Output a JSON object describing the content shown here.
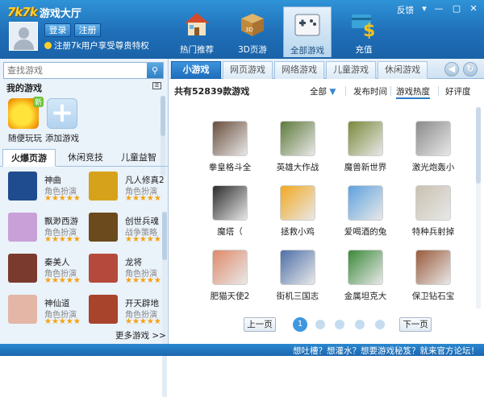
{
  "header": {
    "logo_mark": "7k7k",
    "app_title": "游戏大厅",
    "login_label": "登录",
    "register_label": "注册",
    "promo_text": "注册7k用户享受尊贵特权",
    "feedback_label": "反馈",
    "nav_tabs": [
      {
        "label": "热门推荐",
        "icon": "house-icon",
        "active": false
      },
      {
        "label": "3D页游",
        "icon": "box-icon",
        "active": false
      },
      {
        "label": "全部游戏",
        "icon": "gamepad-icon",
        "active": true
      },
      {
        "label": "充值",
        "icon": "dollar-card-icon",
        "active": false
      }
    ]
  },
  "sidebar": {
    "search_placeholder": "查找游戏",
    "my_games_heading": "我的游戏",
    "my_games": [
      {
        "label": "随便玩玩",
        "badge": "新"
      },
      {
        "label": "添加游戏"
      }
    ],
    "category_tabs": [
      {
        "label": "火爆页游",
        "active": true
      },
      {
        "label": "休闲竞技",
        "active": false
      },
      {
        "label": "儿童益智",
        "active": false
      }
    ],
    "games": [
      {
        "name": "神曲",
        "category": "角色扮演",
        "stars": "★★★★★",
        "color": "#1f4c8f"
      },
      {
        "name": "凡人修真2",
        "category": "角色扮演",
        "stars": "★★★★★",
        "color": "#d6a21c"
      },
      {
        "name": "飘渺西游",
        "category": "角色扮演",
        "stars": "★★★★★",
        "color": "#c9a0d8"
      },
      {
        "name": "创世兵魂",
        "category": "战争策略",
        "stars": "★★★★★",
        "color": "#6b4a1e"
      },
      {
        "name": "秦美人",
        "category": "角色扮演",
        "stars": "★★★★★",
        "color": "#7a3b2e"
      },
      {
        "name": "龙将",
        "category": "角色扮演",
        "stars": "★★★★★",
        "color": "#b54a3c"
      },
      {
        "name": "神仙道",
        "category": "角色扮演",
        "stars": "★★★★★",
        "color": "#e3b6a6"
      },
      {
        "name": "开天辟地",
        "category": "角色扮演",
        "stars": "★★★★★",
        "color": "#a8432c"
      }
    ],
    "more_label": "更多游戏 >>"
  },
  "main": {
    "sub_tabs": [
      {
        "label": "小游戏",
        "active": true
      },
      {
        "label": "网页游戏",
        "active": false
      },
      {
        "label": "网络游戏",
        "active": false
      },
      {
        "label": "儿童游戏",
        "active": false
      },
      {
        "label": "休闲游戏",
        "active": false
      }
    ],
    "total_text": "共有52839款游戏",
    "filters": {
      "all_label": "全部",
      "publish_time": "发布时间",
      "popularity": "游戏热度",
      "rating": "好评度"
    },
    "games": [
      {
        "name": "拳皇格斗全",
        "color": "#6a4e3c"
      },
      {
        "name": "英雄大作战",
        "color": "#5e7a3a"
      },
      {
        "name": "魔兽新世界",
        "color": "#7a8a3a"
      },
      {
        "name": "激光炮轰小",
        "color": "#8a8a8a"
      },
      {
        "name": "魔塔（",
        "color": "#2b2b2b"
      },
      {
        "name": "拯救小鸡",
        "color": "#f2a81f"
      },
      {
        "name": "爱喝酒的兔",
        "color": "#5da2e0"
      },
      {
        "name": "特种兵射掉",
        "color": "#c9c0b0"
      },
      {
        "name": "肥猫天使2",
        "color": "#e08a6a"
      },
      {
        "name": "街机三国志",
        "color": "#4d6fa8"
      },
      {
        "name": "金属坦克大",
        "color": "#3a8a3a"
      },
      {
        "name": "保卫钻石宝",
        "color": "#9a5a3a"
      }
    ],
    "pagination": {
      "prev_label": "上一页",
      "next_label": "下一页",
      "current_page": "1"
    }
  },
  "footer": {
    "text": "想吐槽？想灌水？想要游戏秘笈？就来官方论坛！"
  }
}
